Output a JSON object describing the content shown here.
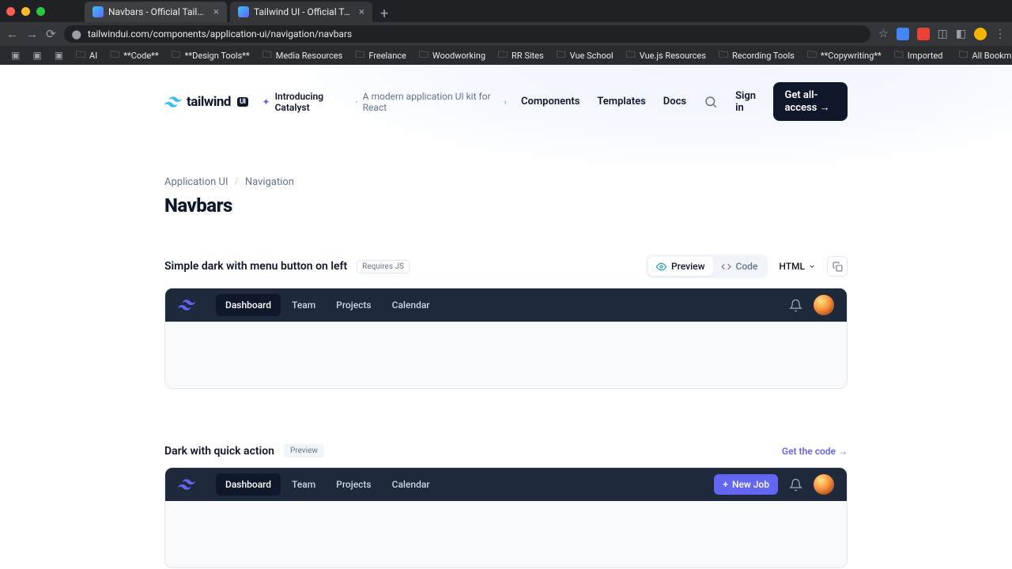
{
  "browser": {
    "tabs": [
      {
        "title": "Navbars - Official Tailwind C"
      },
      {
        "title": "Tailwind UI - Official Tailwind"
      }
    ],
    "url": "tailwindui.com/components/application-ui/navigation/navbars",
    "bookmarks": [
      "AI",
      "**Code**",
      "**Design Tools**",
      "Media Resources",
      "Freelance",
      "Woodworking",
      "RR Sites",
      "Vue School",
      "Vue.js Resources",
      "Recording Tools",
      "**Copywriting**",
      "Imported"
    ],
    "allBookmarks": "All Bookmarks"
  },
  "header": {
    "logoText": "tailwind",
    "logoBadge": "UI",
    "announceTitle": "Introducing Catalyst",
    "announceSub": "A modern application UI kit for React",
    "nav": {
      "components": "Components",
      "templates": "Templates",
      "docs": "Docs"
    },
    "signIn": "Sign in",
    "cta": "Get all-access →"
  },
  "breadcrumb": {
    "a": "Application UI",
    "b": "Navigation"
  },
  "pageTitle": "Navbars",
  "components": [
    {
      "title": "Simple dark with menu button on left",
      "badge": "Requires JS",
      "tools": {
        "preview": "Preview",
        "code": "Code",
        "lang": "HTML"
      },
      "nav": {
        "items": [
          "Dashboard",
          "Team",
          "Projects",
          "Calendar"
        ]
      }
    },
    {
      "title": "Dark with quick action",
      "badge": "Preview",
      "getCode": "Get the code",
      "nav": {
        "items": [
          "Dashboard",
          "Team",
          "Projects",
          "Calendar"
        ],
        "action": "New Job"
      }
    }
  ]
}
